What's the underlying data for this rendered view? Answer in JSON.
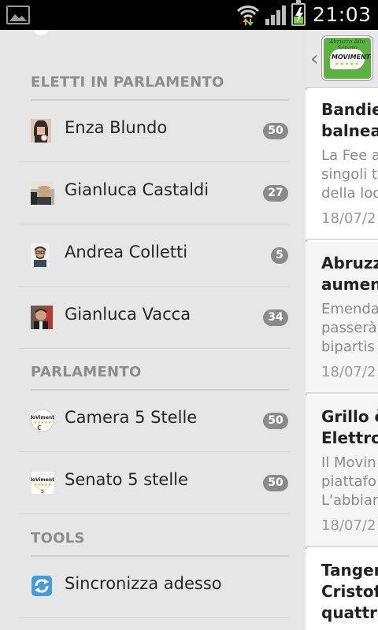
{
  "status_bar": {
    "time": "21:03",
    "icons": [
      "gallery-icon",
      "wifi-icon",
      "signal-icon",
      "battery-charging-icon"
    ]
  },
  "drawer": {
    "sections": [
      {
        "title": "ELETTI IN PARLAMENTO",
        "items": [
          {
            "label": "Enza Blundo",
            "count": "50",
            "icon": "avatar-enza-blundo"
          },
          {
            "label": "Gianluca Castaldi",
            "count": "27",
            "icon": "avatar-gianluca-castaldi"
          },
          {
            "label": "Andrea Colletti",
            "count": "5",
            "icon": "avatar-andrea-colletti"
          },
          {
            "label": "Gianluca Vacca",
            "count": "34",
            "icon": "avatar-gianluca-vacca"
          }
        ]
      },
      {
        "title": "PARLAMENTO",
        "items": [
          {
            "label": "Camera 5 Stelle",
            "count": "50",
            "icon": "movimento-logo-icon"
          },
          {
            "label": "Senato 5 stelle",
            "count": "50",
            "icon": "movimento-logo-icon"
          }
        ]
      },
      {
        "title": "TOOLS",
        "items": [
          {
            "label": "Sincronizza adesso",
            "icon": "sync-icon"
          }
        ]
      }
    ]
  },
  "action_bar": {
    "back_icon": "chevron-left-icon",
    "logo_text": "Abruzzo Alto Sangro",
    "logo_word": "MOVIMENTO",
    "logo_stars": "★★★★★"
  },
  "articles": [
    {
      "title_lines": [
        "Bandie",
        "balnea"
      ],
      "snippet_lines": [
        "La Fee a",
        "singoli t",
        "della loc"
      ],
      "date": "18/07/2"
    },
    {
      "title_lines": [
        "Abruzz",
        "aumen"
      ],
      "snippet_lines": [
        "Emenda",
        "passerà",
        "bipartis"
      ],
      "date": "18/07/2"
    },
    {
      "title_lines": [
        "Grillo è",
        "Elettror"
      ],
      "snippet_lines": [
        "Il Movin",
        "piattafo",
        "L'abbiam"
      ],
      "date": "18/07/2"
    },
    {
      "title_lines": [
        "Tanger",
        "Cristof",
        "quattro"
      ],
      "snippet_lines": [],
      "date": ""
    }
  ],
  "colors": {
    "drawer_bg": "#e6e6e6",
    "badge_bg": "#8a8a8a",
    "section_text": "#8c8c8c",
    "status_bar": "#000000",
    "battery_green": "#7bd23a",
    "logo_green": "#5db042"
  }
}
